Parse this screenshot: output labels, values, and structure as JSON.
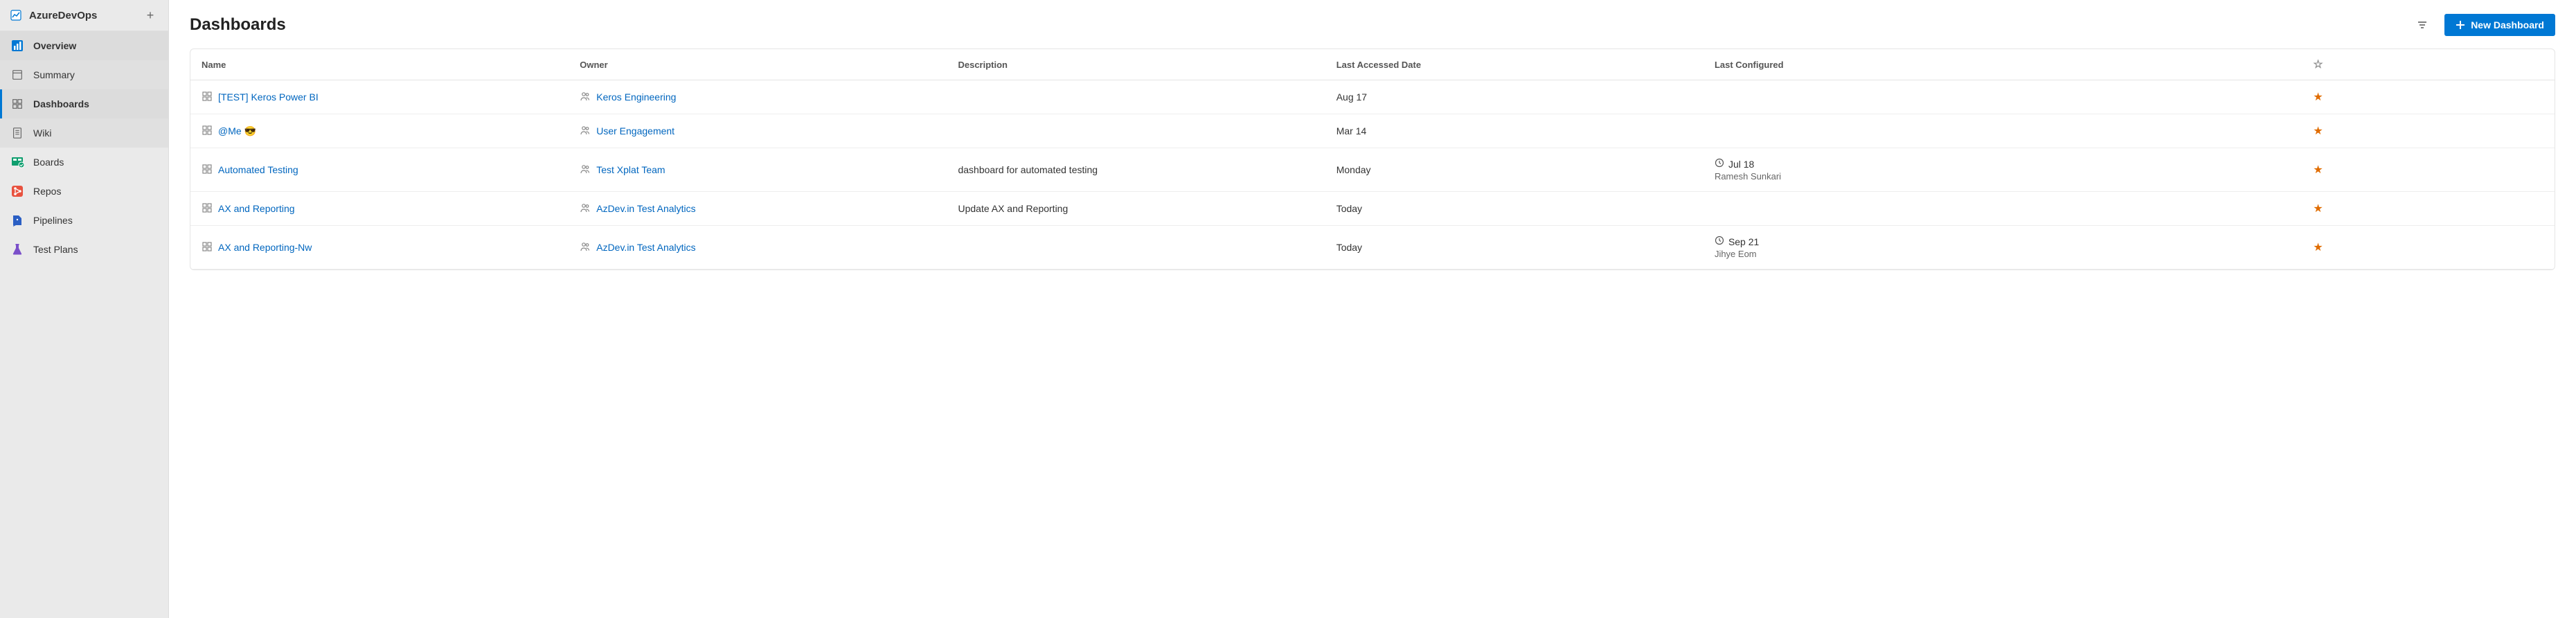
{
  "sidebar": {
    "project": "AzureDevOps",
    "items": [
      {
        "label": "Overview",
        "icon": "overview"
      },
      {
        "label": "Summary",
        "icon": "summary"
      },
      {
        "label": "Dashboards",
        "icon": "dashboards"
      },
      {
        "label": "Wiki",
        "icon": "wiki"
      },
      {
        "label": "Boards",
        "icon": "boards"
      },
      {
        "label": "Repos",
        "icon": "repos"
      },
      {
        "label": "Pipelines",
        "icon": "pipelines"
      },
      {
        "label": "Test Plans",
        "icon": "testplans"
      }
    ]
  },
  "page": {
    "title": "Dashboards",
    "new_button": "New Dashboard"
  },
  "table": {
    "columns": {
      "name": "Name",
      "owner": "Owner",
      "description": "Description",
      "last_accessed": "Last Accessed Date",
      "last_configured": "Last Configured"
    },
    "rows": [
      {
        "name": "[TEST] Keros Power BI",
        "owner": "Keros Engineering",
        "description": "",
        "last_accessed": "Aug 17",
        "last_configured_date": "",
        "last_configured_by": "",
        "starred": true
      },
      {
        "name": "@Me 😎",
        "owner": "User Engagement",
        "description": "",
        "last_accessed": "Mar 14",
        "last_configured_date": "",
        "last_configured_by": "",
        "starred": true
      },
      {
        "name": "Automated Testing",
        "owner": "Test Xplat Team",
        "description": "dashboard for automated testing",
        "last_accessed": "Monday",
        "last_configured_date": "Jul 18",
        "last_configured_by": "Ramesh Sunkari",
        "starred": true
      },
      {
        "name": "AX and Reporting",
        "owner": "AzDev.in Test Analytics",
        "description": "Update AX and Reporting",
        "last_accessed": "Today",
        "last_configured_date": "",
        "last_configured_by": "",
        "starred": true
      },
      {
        "name": "AX and Reporting-Nw",
        "owner": "AzDev.in Test Analytics",
        "description": "",
        "last_accessed": "Today",
        "last_configured_date": "Sep 21",
        "last_configured_by": "Jihye Eom",
        "starred": true
      }
    ]
  }
}
